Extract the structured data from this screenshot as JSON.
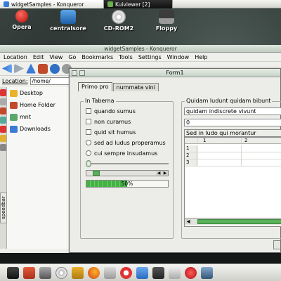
{
  "taskbar": {
    "tasks": [
      {
        "label": "widgetSamples - Konqueror"
      },
      {
        "label": "Kuiviewer [2]"
      }
    ]
  },
  "desktop_icons": [
    {
      "label": "Opera"
    },
    {
      "label": "centralsore"
    },
    {
      "label": "CD-ROM2"
    },
    {
      "label": "Floppy"
    }
  ],
  "konqueror": {
    "title": "widgetSamples - Konqueror",
    "menu": [
      "Location",
      "Edit",
      "View",
      "Go",
      "Bookmarks",
      "Tools",
      "Settings",
      "Window",
      "Help"
    ],
    "location_label": "Location:",
    "location_value": "/home/",
    "sidebar": {
      "speedbar_label": "speedbar",
      "items": [
        {
          "label": "Desktop"
        },
        {
          "label": "Home Folder"
        },
        {
          "label": "mnt"
        },
        {
          "label": "Downloads"
        }
      ]
    }
  },
  "form": {
    "title": "Form1",
    "tabs": [
      {
        "label": "Primo pro",
        "active": true
      },
      {
        "label": "nummata vini",
        "active": false
      }
    ],
    "left_group": {
      "title": "In Taberna",
      "checkboxes": [
        {
          "label": "quando sumus",
          "checked": false
        },
        {
          "label": "non curamus",
          "checked": false
        },
        {
          "label": "quid sit humus",
          "checked": false
        }
      ],
      "radios": [
        {
          "label": "sed ad ludus properamus",
          "selected": false
        },
        {
          "label": "cui sempre insudamus",
          "selected": false
        }
      ],
      "slider_value": 0,
      "scroll_position": 0.05,
      "progress": {
        "value": 50,
        "label": "50%"
      }
    },
    "right_group": {
      "title": "Quidam ludunt quidam bibunt",
      "text_field": "quidam indiscrete vivunt",
      "spin_value": "0",
      "combo_value": "Sed in ludo qui morantur",
      "table": {
        "columns": [
          "1",
          "2"
        ],
        "rows": [
          "1",
          "2",
          "3"
        ]
      }
    }
  },
  "colors": {
    "accent_green": "#58b058",
    "title_green": "#c8d4c8"
  }
}
